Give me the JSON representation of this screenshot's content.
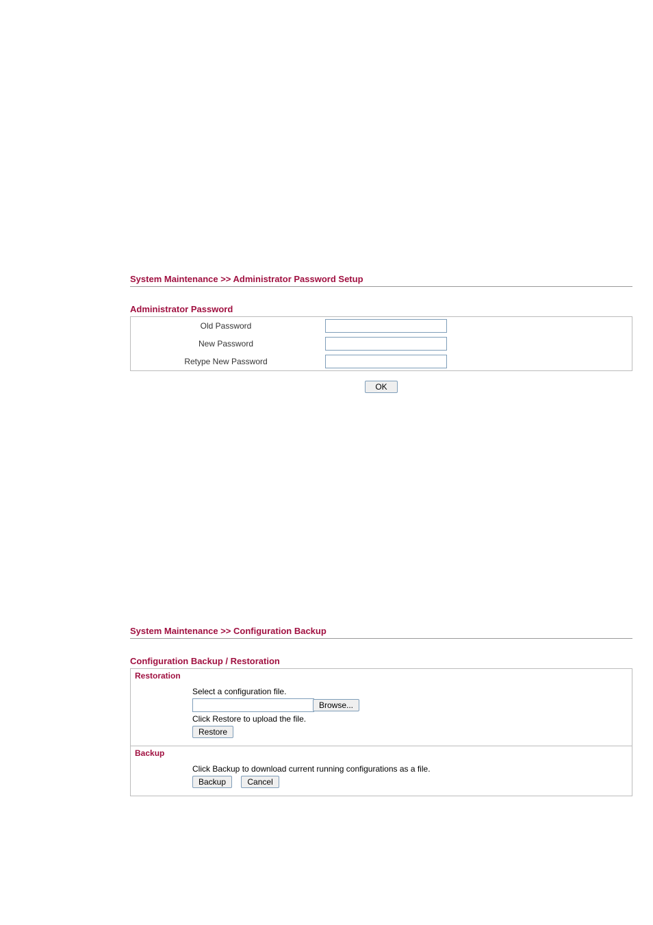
{
  "admin_password": {
    "breadcrumb": "System Maintenance >> Administrator Password Setup",
    "panel_title": "Administrator Password",
    "old_label": "Old Password",
    "new_label": "New Password",
    "retype_label": "Retype New Password",
    "old_value": "",
    "new_value": "",
    "retype_value": "",
    "ok_label": "OK"
  },
  "config_backup": {
    "breadcrumb": "System Maintenance >> Configuration Backup",
    "panel_title": "Configuration Backup / Restoration",
    "restoration_header": "Restoration",
    "select_text": "Select a configuration file.",
    "browse_label": "Browse...",
    "file_value": "",
    "click_restore_text": "Click Restore to upload the file.",
    "restore_label": "Restore",
    "backup_header": "Backup",
    "click_backup_text": "Click Backup to download current running configurations as a file.",
    "backup_label": "Backup",
    "cancel_label": "Cancel"
  }
}
